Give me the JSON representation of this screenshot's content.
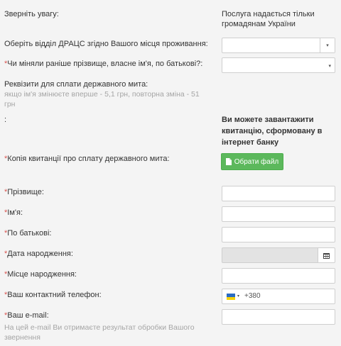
{
  "notice": {
    "label": "Зверніть увагу:",
    "text": "Послуга надається тільки громадянам України"
  },
  "office": {
    "label": "Оберіть відділ ДРАЦС згідно Вашого місця проживання:",
    "value": "",
    "caret": "▾"
  },
  "name_change": {
    "req": "*",
    "label": "Чи міняли раніше прізвище, власне ім'я, по батькові?:",
    "value": "",
    "caret": "▾"
  },
  "requisites": {
    "label": "Реквізити для сплати державного мита:",
    "hint": "якщо ім'я змінюєте вперше - 5,1 грн, повторна зміна - 51 грн"
  },
  "download_note": {
    "label": ":",
    "text": "Ви можете завантажити квитанцію, сформовану в інтернет банку"
  },
  "receipt": {
    "req": "*",
    "label": "Копія квитанції про сплату державного мита:",
    "button": "Обрати файл",
    "icon": "file-icon"
  },
  "fields": {
    "surname": {
      "req": "*",
      "label": "Прізвище:",
      "value": ""
    },
    "name": {
      "req": "*",
      "label": "Ім'я:",
      "value": ""
    },
    "patronymic": {
      "req": "*",
      "label": "По батькові:",
      "value": ""
    },
    "birth_date": {
      "req": "*",
      "label": "Дата народження:",
      "value": "",
      "icon": "calendar-icon"
    },
    "birth_place": {
      "req": "*",
      "label": "Місце народження:",
      "value": ""
    },
    "phone": {
      "req": "*",
      "label": "Ваш контактний телефон:",
      "code": "+380",
      "caret": "▾",
      "flag_colors": [
        "#2a6cc2",
        "#f5d10a"
      ]
    },
    "email": {
      "req": "*",
      "label": "Ваш e-mail:",
      "value": "",
      "hint": "На цей e-mail Ви отримаєте результат обробки Вашого звернення"
    }
  },
  "colors": {
    "required": "#d9534f",
    "button_bg": "#5cb85c",
    "page_bg": "#f4f4f4"
  }
}
